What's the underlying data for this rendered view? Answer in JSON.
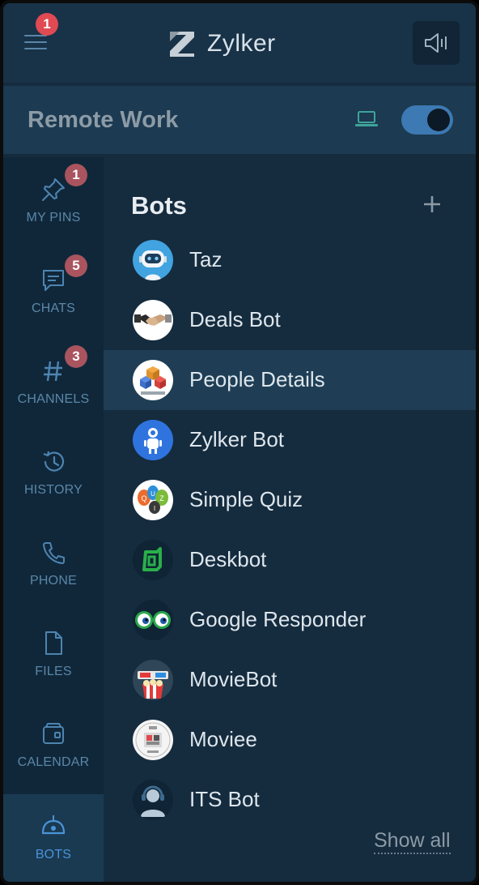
{
  "header": {
    "menu_badge": "1",
    "app_name": "Zylker"
  },
  "workspace": {
    "title": "Remote Work",
    "toggle_on": true
  },
  "sidebar": {
    "items": [
      {
        "label": "MY PINS",
        "icon": "pin-icon",
        "badge": "1"
      },
      {
        "label": "CHATS",
        "icon": "chat-icon",
        "badge": "5"
      },
      {
        "label": "CHANNELS",
        "icon": "hash-icon",
        "badge": "3"
      },
      {
        "label": "HISTORY",
        "icon": "history-icon",
        "badge": ""
      },
      {
        "label": "PHONE",
        "icon": "phone-icon",
        "badge": ""
      },
      {
        "label": "FILES",
        "icon": "file-icon",
        "badge": ""
      },
      {
        "label": "CALENDAR",
        "icon": "calendar-icon",
        "badge": ""
      }
    ],
    "active_tab": {
      "label": "BOTS",
      "icon": "bot-icon"
    }
  },
  "panel": {
    "title": "Bots",
    "bots": [
      {
        "name": "Taz",
        "avatar": "robot-avatar"
      },
      {
        "name": "Deals Bot",
        "avatar": "handshake-avatar"
      },
      {
        "name": "People Details",
        "avatar": "cubes-avatar",
        "selected": true
      },
      {
        "name": "Zylker Bot",
        "avatar": "zylker-robot-avatar"
      },
      {
        "name": "Simple Quiz",
        "avatar": "quiz-bubbles-avatar"
      },
      {
        "name": "Deskbot",
        "avatar": "deskbot-logo-avatar"
      },
      {
        "name": "Google Responder",
        "avatar": "eyes-avatar"
      },
      {
        "name": "MovieBot",
        "avatar": "3d-glasses-popcorn-avatar"
      },
      {
        "name": "Moviee",
        "avatar": "cinema-ticket-avatar"
      },
      {
        "name": "ITS Bot",
        "avatar": "headset-agent-avatar"
      }
    ],
    "show_all": "Show all"
  },
  "colors": {
    "background": "#152b3e",
    "accent": "#4a93d8",
    "badge_red": "#e04a52",
    "badge_muted": "#a9545e"
  }
}
